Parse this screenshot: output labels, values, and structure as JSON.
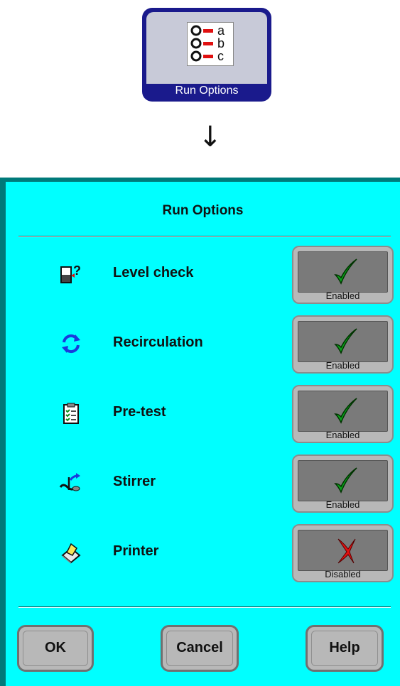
{
  "launcher": {
    "label": "Run Options",
    "icon_letters": [
      "a",
      "b",
      "c"
    ],
    "icon": "options-list-icon"
  },
  "arrow": "↓",
  "dialog": {
    "title": "Run Options",
    "background": "#00ffff",
    "options": [
      {
        "icon": "level-check-icon",
        "label": "Level check",
        "state": "Enabled",
        "enabled": true
      },
      {
        "icon": "recirculation-icon",
        "label": "Recirculation",
        "state": "Enabled",
        "enabled": true
      },
      {
        "icon": "clipboard-icon",
        "label": "Pre-test",
        "state": "Enabled",
        "enabled": true
      },
      {
        "icon": "stirrer-icon",
        "label": "Stirrer",
        "state": "Enabled",
        "enabled": true
      },
      {
        "icon": "printer-icon",
        "label": "Printer",
        "state": "Disabled",
        "enabled": false
      }
    ],
    "buttons": {
      "ok": "OK",
      "cancel": "Cancel",
      "help": "Help"
    }
  },
  "colors": {
    "check": "#0aa01a",
    "cross": "#e01010",
    "accent": "#1a1a8c"
  }
}
